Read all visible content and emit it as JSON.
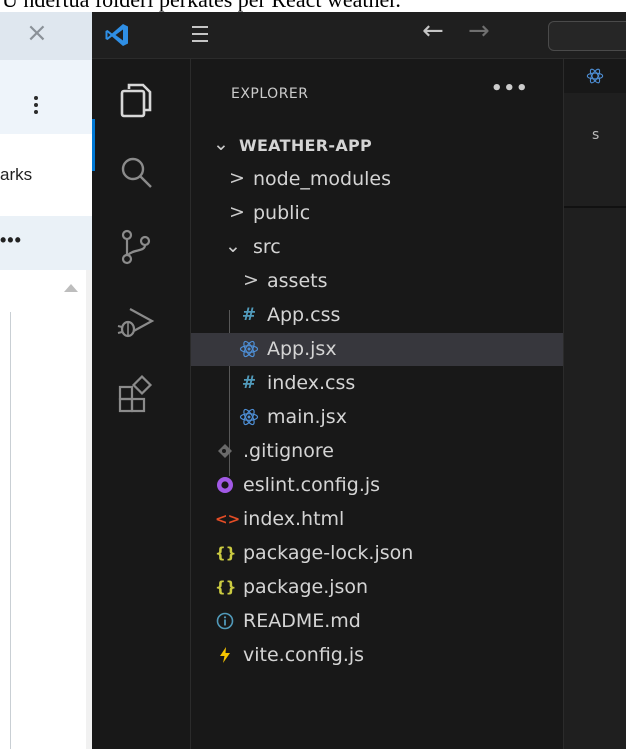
{
  "caption": "U ndertua folderi përkatës për React weather.",
  "browser": {
    "bookmarks_label": "arks",
    "more_label": "•••"
  },
  "explorer": {
    "title": "EXPLORER",
    "more": "•••",
    "root": "WEATHER-APP",
    "items": [
      {
        "label": "node_modules"
      },
      {
        "label": "public"
      },
      {
        "label": "src"
      },
      {
        "label": "assets"
      },
      {
        "label": "App.css"
      },
      {
        "label": "App.jsx"
      },
      {
        "label": "index.css"
      },
      {
        "label": "main.jsx"
      },
      {
        "label": ".gitignore"
      },
      {
        "label": "eslint.config.js"
      },
      {
        "label": "index.html"
      },
      {
        "label": "package-lock.json"
      },
      {
        "label": "package.json"
      },
      {
        "label": "README.md"
      },
      {
        "label": "vite.config.js"
      }
    ]
  },
  "editor": {
    "breadcrumb": "s"
  },
  "colors": {
    "accent": "#0078d4",
    "css_hash": "#519aba",
    "react": "#4e8fd6",
    "eslint": "#a259e6",
    "html": "#e44d26",
    "json": "#cbcb41",
    "info": "#519aba",
    "vite": "#f5c400"
  },
  "icons": {
    "logo": "vscode-logo-icon",
    "explorer": "files-icon",
    "search": "search-icon",
    "scm": "source-control-icon",
    "debug": "run-debug-icon",
    "extensions": "extensions-icon"
  }
}
